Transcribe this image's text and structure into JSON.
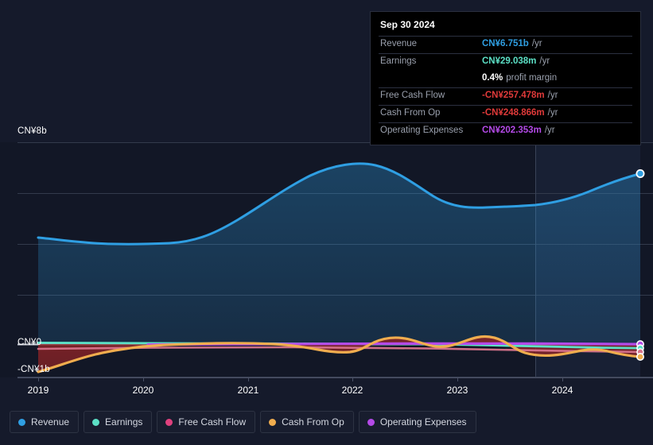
{
  "chart_data": {
    "type": "area",
    "title": "",
    "currency": "CN¥",
    "xlabel": "",
    "ylabel": "",
    "grid": true,
    "legend_position": "bottom-left",
    "x_ticks": [
      "2019",
      "2020",
      "2021",
      "2022",
      "2023",
      "2024"
    ],
    "y_ticks": [
      "CN¥8b",
      "CN¥0",
      "-CN¥1b"
    ],
    "ylim": [
      -1,
      8
    ],
    "forecast_divider_x": "2023.75",
    "series": [
      {
        "name": "Revenue",
        "color": "#2f9fe3",
        "x": [
          2018.95,
          2019.4,
          2019.9,
          2020.3,
          2020.75,
          2021.2,
          2021.65,
          2022.0,
          2022.35,
          2022.7,
          2023.0,
          2023.4,
          2023.8,
          2024.2,
          2024.75
        ],
        "values": [
          4.05,
          3.92,
          3.84,
          4.08,
          4.75,
          5.45,
          6.1,
          6.45,
          6.35,
          5.85,
          5.35,
          5.3,
          5.55,
          6.1,
          6.751
        ]
      },
      {
        "name": "Earnings",
        "color": "#5ce0c6",
        "x": [
          2018.95,
          2019.9,
          2020.75,
          2021.65,
          2022.35,
          2023.0,
          2023.8,
          2024.75
        ],
        "values": [
          0.035,
          0.03,
          0.025,
          0.02,
          0.018,
          0.015,
          0.02,
          0.029
        ]
      },
      {
        "name": "Free Cash Flow",
        "color": "#e0417e",
        "x": [
          2018.95,
          2019.9,
          2020.75,
          2021.65,
          2022.35,
          2023.0,
          2023.8,
          2024.75
        ],
        "values": [
          -0.12,
          -0.1,
          -0.07,
          -0.06,
          -0.08,
          -0.14,
          -0.18,
          -0.257
        ]
      },
      {
        "name": "Cash From Op",
        "color": "#f0ad4e",
        "x": [
          2018.95,
          2019.35,
          2019.9,
          2020.4,
          2020.9,
          2021.35,
          2021.7,
          2022.0,
          2022.25,
          2022.5,
          2022.8,
          2023.05,
          2023.4,
          2023.8,
          2024.2,
          2024.75
        ],
        "values": [
          -0.98,
          -0.72,
          -0.32,
          -0.08,
          -0.05,
          -0.2,
          -0.38,
          0.1,
          0.06,
          0.2,
          -0.35,
          -0.42,
          -0.24,
          -0.14,
          -0.3,
          -0.249
        ]
      },
      {
        "name": "Operating Expenses",
        "color": "#b44ae8",
        "x": [
          2020.35,
          2021.0,
          2021.7,
          2022.35,
          2023.0,
          2023.8,
          2024.75
        ],
        "values": [
          0.12,
          0.13,
          0.14,
          0.15,
          0.17,
          0.19,
          0.202
        ]
      }
    ]
  },
  "tooltip": {
    "date": "Sep 30 2024",
    "rows": [
      {
        "key": "Revenue",
        "value": "CN¥6.751b",
        "unit": "/yr",
        "color": "#2f9fe3"
      },
      {
        "key": "Earnings",
        "value": "CN¥29.038m",
        "unit": "/yr",
        "color": "#5ce0c6"
      },
      {
        "key": "",
        "value": "0.4%",
        "unit": "profit margin",
        "color": "#ffffff"
      },
      {
        "key": "Free Cash Flow",
        "value": "-CN¥257.478m",
        "unit": "/yr",
        "color": "#e03a3a"
      },
      {
        "key": "Cash From Op",
        "value": "-CN¥248.866m",
        "unit": "/yr",
        "color": "#e03a3a"
      },
      {
        "key": "Operating Expenses",
        "value": "CN¥202.353m",
        "unit": "/yr",
        "color": "#b44ae8"
      }
    ]
  },
  "axis": {
    "y_top_label": "CN¥8b",
    "y_zero_label": "CN¥0",
    "y_bottom_label": "-CN¥1b",
    "x_labels": [
      "2019",
      "2020",
      "2021",
      "2022",
      "2023",
      "2024"
    ]
  },
  "legend": {
    "items": [
      {
        "label": "Revenue",
        "color": "#2f9fe3"
      },
      {
        "label": "Earnings",
        "color": "#5ce0c6"
      },
      {
        "label": "Free Cash Flow",
        "color": "#e0417e"
      },
      {
        "label": "Cash From Op",
        "color": "#f0ad4e"
      },
      {
        "label": "Operating Expenses",
        "color": "#b44ae8"
      }
    ]
  }
}
